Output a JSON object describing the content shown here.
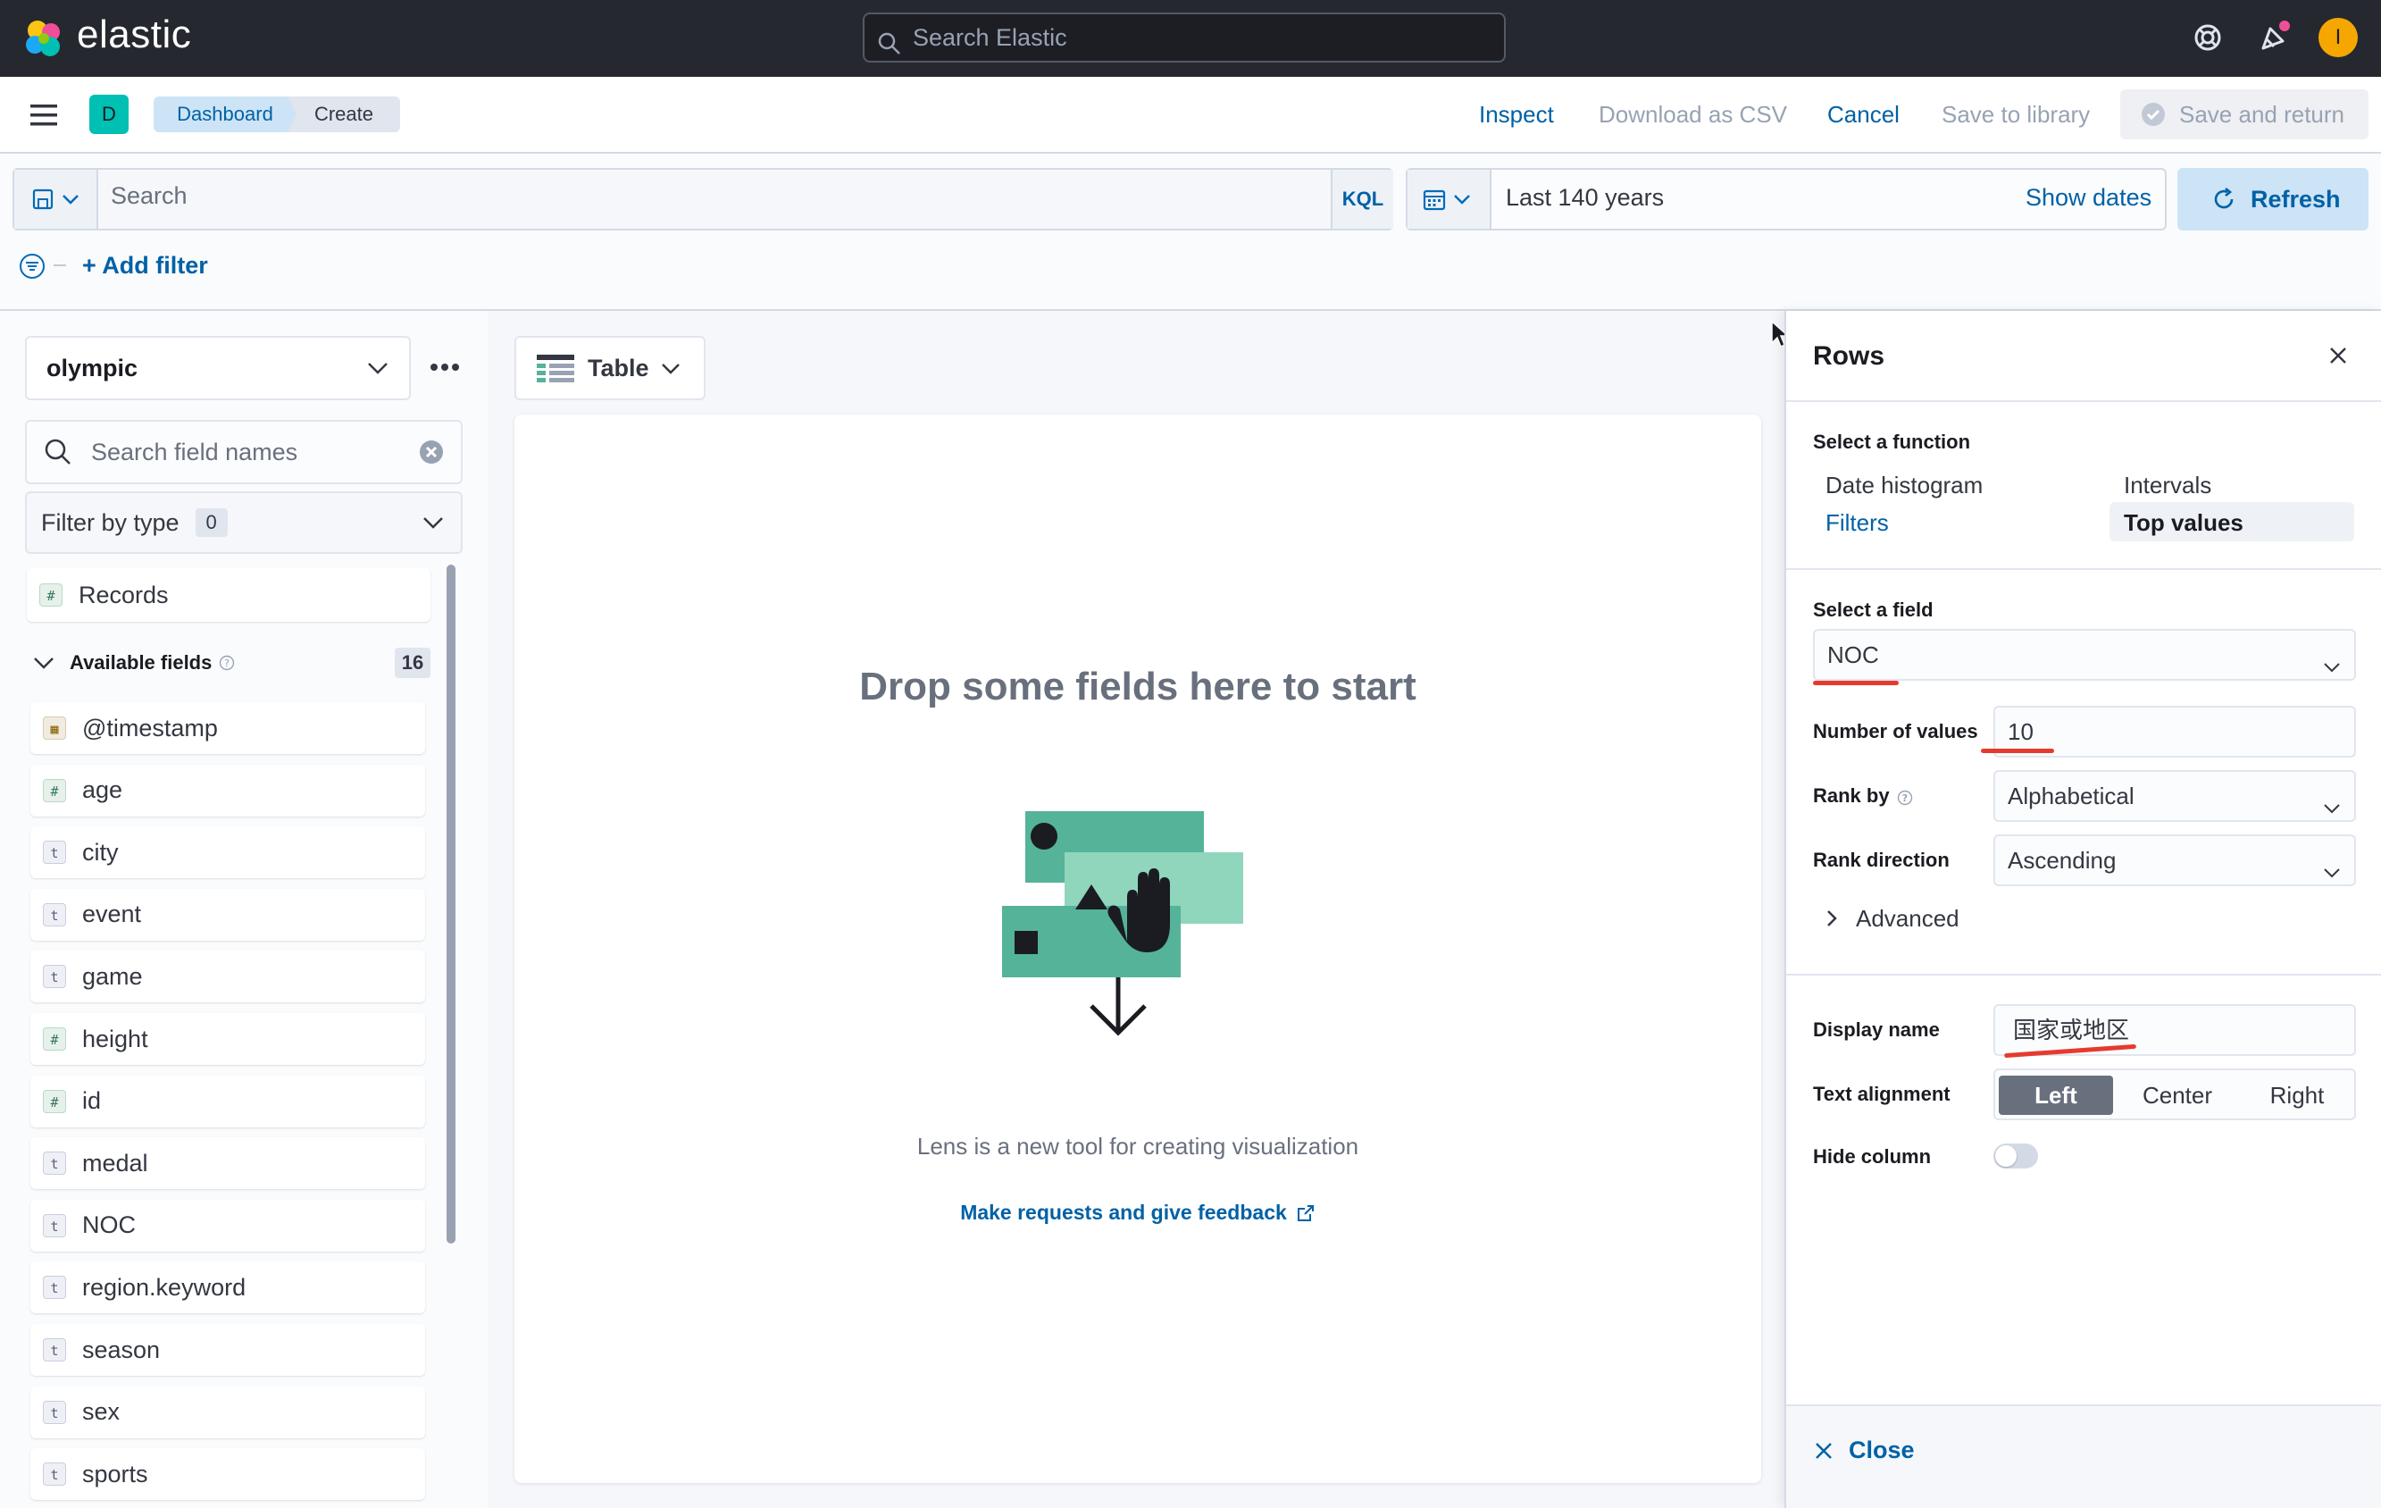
{
  "header": {
    "brand": "elastic",
    "search_placeholder": "Search Elastic",
    "avatar_initial": "I"
  },
  "subheader": {
    "space_initial": "D",
    "breadcrumbs": [
      "Dashboard",
      "Create"
    ],
    "actions": {
      "inspect": "Inspect",
      "download": "Download as CSV",
      "cancel": "Cancel",
      "save_library": "Save to library",
      "save_return": "Save and return"
    }
  },
  "querybar": {
    "placeholder": "Search",
    "language": "KQL",
    "date_range": "Last 140 years",
    "show_dates": "Show dates",
    "refresh": "Refresh",
    "add_filter": "+ Add filter"
  },
  "datasource": {
    "index_pattern": "olympic",
    "field_search_placeholder": "Search field names",
    "filter_by_type": "Filter by type",
    "filter_count": "0",
    "records": "Records",
    "available_fields_label": "Available fields",
    "available_fields_count": "16",
    "fields": [
      {
        "name": "@timestamp",
        "type": "date"
      },
      {
        "name": "age",
        "type": "number"
      },
      {
        "name": "city",
        "type": "text"
      },
      {
        "name": "event",
        "type": "text"
      },
      {
        "name": "game",
        "type": "text"
      },
      {
        "name": "height",
        "type": "number"
      },
      {
        "name": "id",
        "type": "number"
      },
      {
        "name": "medal",
        "type": "text"
      },
      {
        "name": "NOC",
        "type": "text"
      },
      {
        "name": "region.keyword",
        "type": "text"
      },
      {
        "name": "season",
        "type": "text"
      },
      {
        "name": "sex",
        "type": "text"
      },
      {
        "name": "sports",
        "type": "text"
      }
    ]
  },
  "workspace": {
    "vis_type": "Table",
    "empty_title": "Drop some fields here to start",
    "empty_subtitle": "Lens is a new tool for creating visualization",
    "feedback_link": "Make requests and give feedback"
  },
  "flyout": {
    "title": "Rows",
    "select_function_label": "Select a function",
    "functions": [
      "Date histogram",
      "Intervals",
      "Filters",
      "Top values"
    ],
    "selected_function": "Top values",
    "select_field_label": "Select a field",
    "field_value": "NOC",
    "number_of_values_label": "Number of values",
    "number_of_values": "10",
    "rank_by_label": "Rank by",
    "rank_by_value": "Alphabetical",
    "rank_direction_label": "Rank direction",
    "rank_direction_value": "Ascending",
    "advanced": "Advanced",
    "display_name_label": "Display name",
    "display_name_value": "国家或地区",
    "text_alignment_label": "Text alignment",
    "alignments": [
      "Left",
      "Center",
      "Right"
    ],
    "selected_alignment": "Left",
    "hide_column_label": "Hide column",
    "hide_column": false,
    "close": "Close"
  },
  "colors": {
    "accent": "#0077cc",
    "header_bg": "#25282f",
    "success": "#54b399",
    "annotation": "#e53b2e"
  }
}
